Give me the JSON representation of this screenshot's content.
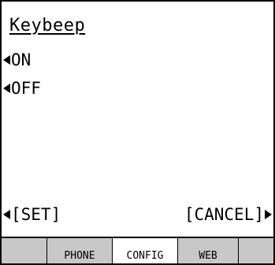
{
  "screen": {
    "title": "Keybeep"
  },
  "options": [
    {
      "label": "ON"
    },
    {
      "label": "OFF"
    }
  ],
  "softkeys": {
    "left_label": "[SET]",
    "right_label": "[CANCEL]"
  },
  "tabs": [
    {
      "label": ""
    },
    {
      "label": "PHONE"
    },
    {
      "label": "CONFIG",
      "selected": true
    },
    {
      "label": "WEB"
    },
    {
      "label": ""
    }
  ],
  "colors": {
    "background": "#ffffff",
    "text": "#000000",
    "tab_inactive": "#c8c8c8",
    "tab_selected": "#ffffff"
  },
  "icons": {
    "option_marker": "triangle-left-icon",
    "left_softkey_marker": "triangle-left-icon",
    "right_softkey_marker": "triangle-right-icon"
  }
}
